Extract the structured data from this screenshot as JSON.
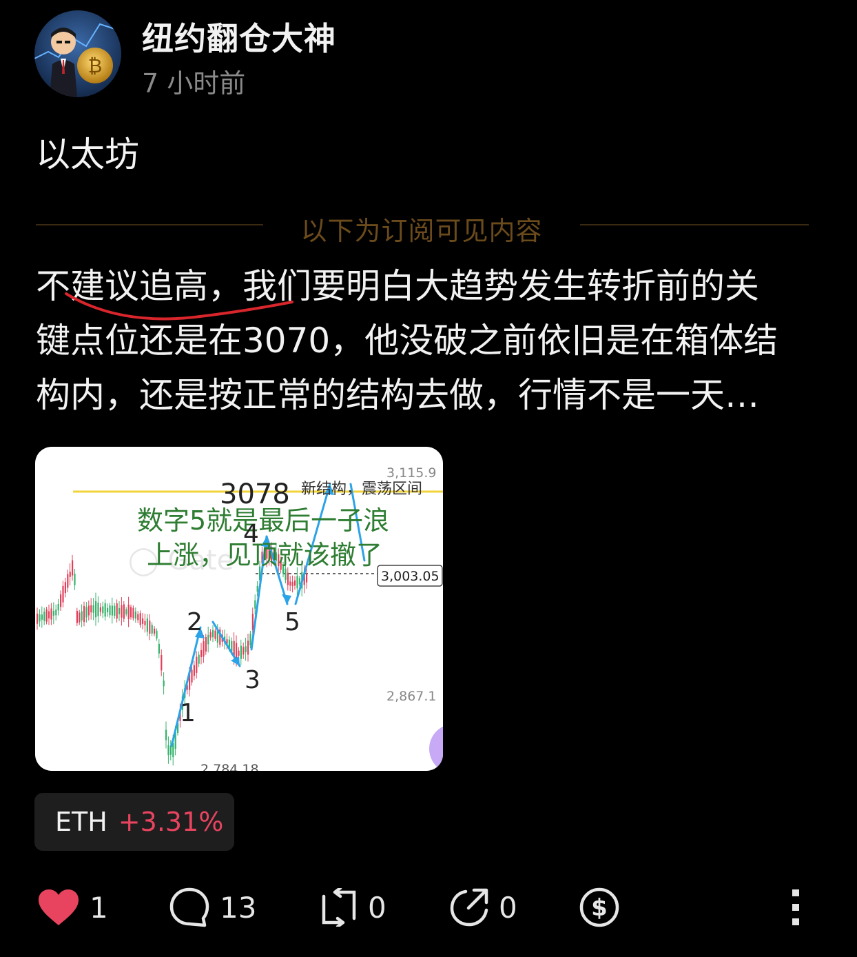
{
  "author": {
    "name": "纽约翻仓大神",
    "time": "7 小时前"
  },
  "post": {
    "title": "以太坊",
    "subscription_divider": "以下为订阅可见内容",
    "body_lines": [
      "不建议追高，我们要明白大趋势发生转折前的关",
      "键点位还是在3070，他没破之前依旧是在箱体结",
      "构内，还是按正常的结构去做，行情不是一天…"
    ]
  },
  "chart_image": {
    "price_labels": [
      "3,115.9",
      "3,003.05",
      "2,867.1",
      "2,784.18"
    ],
    "current_price": "3,003.05",
    "level_label": "3078",
    "structure_note": "新结构，震荡区间",
    "caption_line1": "数字5就是最后一子浪",
    "caption_line2": "上涨，见顶就该撤了",
    "wave_labels": [
      "1",
      "2",
      "3",
      "4",
      "5"
    ]
  },
  "ticker": {
    "symbol": "ETH",
    "change": "+3.31%"
  },
  "actions": {
    "likes": "1",
    "comments": "13",
    "reposts": "0",
    "shares": "0"
  },
  "colors": {
    "background": "#000000",
    "like_red": "#e8445f",
    "gain_red": "#e8445f",
    "divider_gold": "#6b4b1c",
    "caption_green": "#2e7d32",
    "wave_blue": "#2aa3e8"
  }
}
